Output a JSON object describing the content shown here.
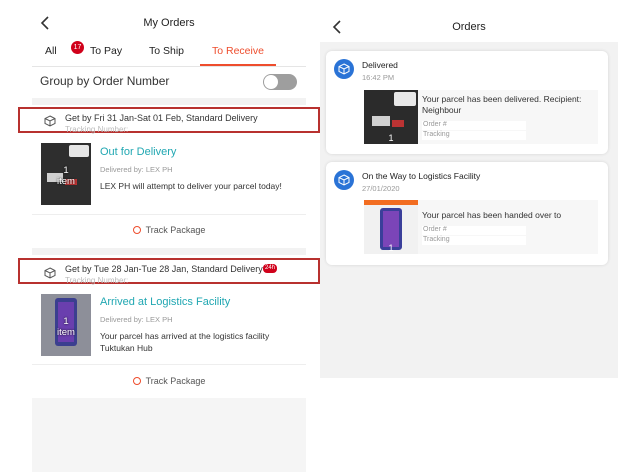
{
  "left": {
    "title": "My Orders",
    "back_icon": "chevron-left-icon",
    "tabs": [
      {
        "label": "All",
        "badge": "17"
      },
      {
        "label": "To Pay"
      },
      {
        "label": "To Ship"
      },
      {
        "label": "To Receive",
        "active": true
      }
    ],
    "group_by_label": "Group by Order Number",
    "toggle_on": false,
    "orders": [
      {
        "shipping": "Get by Fri 31 Jan-Sat 01 Feb, Standard Delivery",
        "tracking_label": "Tracking Number:",
        "thumb_label_line1": "1",
        "thumb_label_line2": "item",
        "status": "Out for Delivery",
        "delivered_by": "Delivered by: LEX PH",
        "description": "LEX PH will attempt to deliver your parcel today!",
        "track_label": "Track Package"
      },
      {
        "shipping": "Get by Tue 28 Jan-Tue 28 Jan, Standard Delivery",
        "badge": "24h",
        "tracking_label": "Tracking Number:",
        "thumb_label_line1": "1",
        "thumb_label_line2": "item",
        "status": "Arrived at Logistics Facility",
        "delivered_by": "Delivered by: LEX PH",
        "description": "Your parcel has arrived at the logistics facility Tuktukan Hub",
        "track_label": "Track Package"
      }
    ]
  },
  "right": {
    "title": "Orders",
    "back_icon": "chevron-left-icon",
    "cards": [
      {
        "title": "Delivered",
        "time": "16:42 PM",
        "message": "Your parcel has been delivered. Recipient: Neighbour",
        "order_label": "Order #",
        "tracking_label": "Tracking",
        "qty": "1"
      },
      {
        "title": "On the Way to Logistics Facility",
        "time": "27/01/2020",
        "message": "Your parcel has been handed over to",
        "order_label": "Order #",
        "tracking_label": "Tracking",
        "qty": "1"
      }
    ]
  },
  "colors": {
    "accent": "#ee4d2d",
    "status_teal": "#20a7b2",
    "highlight_border": "#b8312f",
    "icon_blue": "#2a73d6"
  }
}
